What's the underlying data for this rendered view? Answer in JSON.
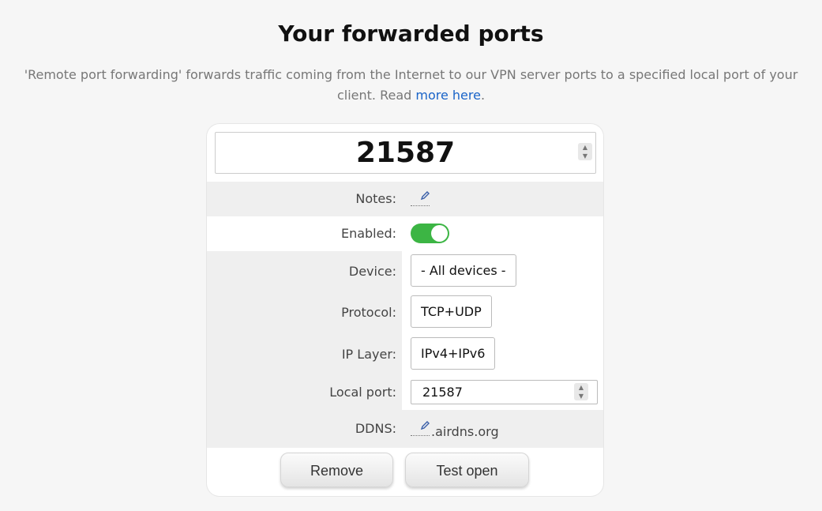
{
  "page": {
    "title": "Your forwarded ports",
    "intro_text": "'Remote port forwarding' forwards traffic coming from the Internet to our VPN server ports to a specified local port of your client. Read ",
    "intro_link": "more here",
    "intro_end": "."
  },
  "port": {
    "number": "21587"
  },
  "fields": {
    "notes_label": "Notes:",
    "enabled_label": "Enabled:",
    "enabled": true,
    "device_label": "Device:",
    "device_value": "- All devices -",
    "protocol_label": "Protocol:",
    "protocol_value": "TCP+UDP",
    "ip_layer_label": "IP Layer:",
    "ip_layer_value": "IPv4+IPv6",
    "local_port_label": "Local port:",
    "local_port_value": "21587",
    "ddns_label": "DDNS:",
    "ddns_suffix": ".airdns.org"
  },
  "buttons": {
    "remove": "Remove",
    "test_open": "Test open"
  },
  "colors": {
    "toggle_on": "#3cb544",
    "link": "#1a64c8"
  },
  "icons": {
    "edit": "pencil-icon",
    "spinner": "chevron-up-down-icon"
  }
}
